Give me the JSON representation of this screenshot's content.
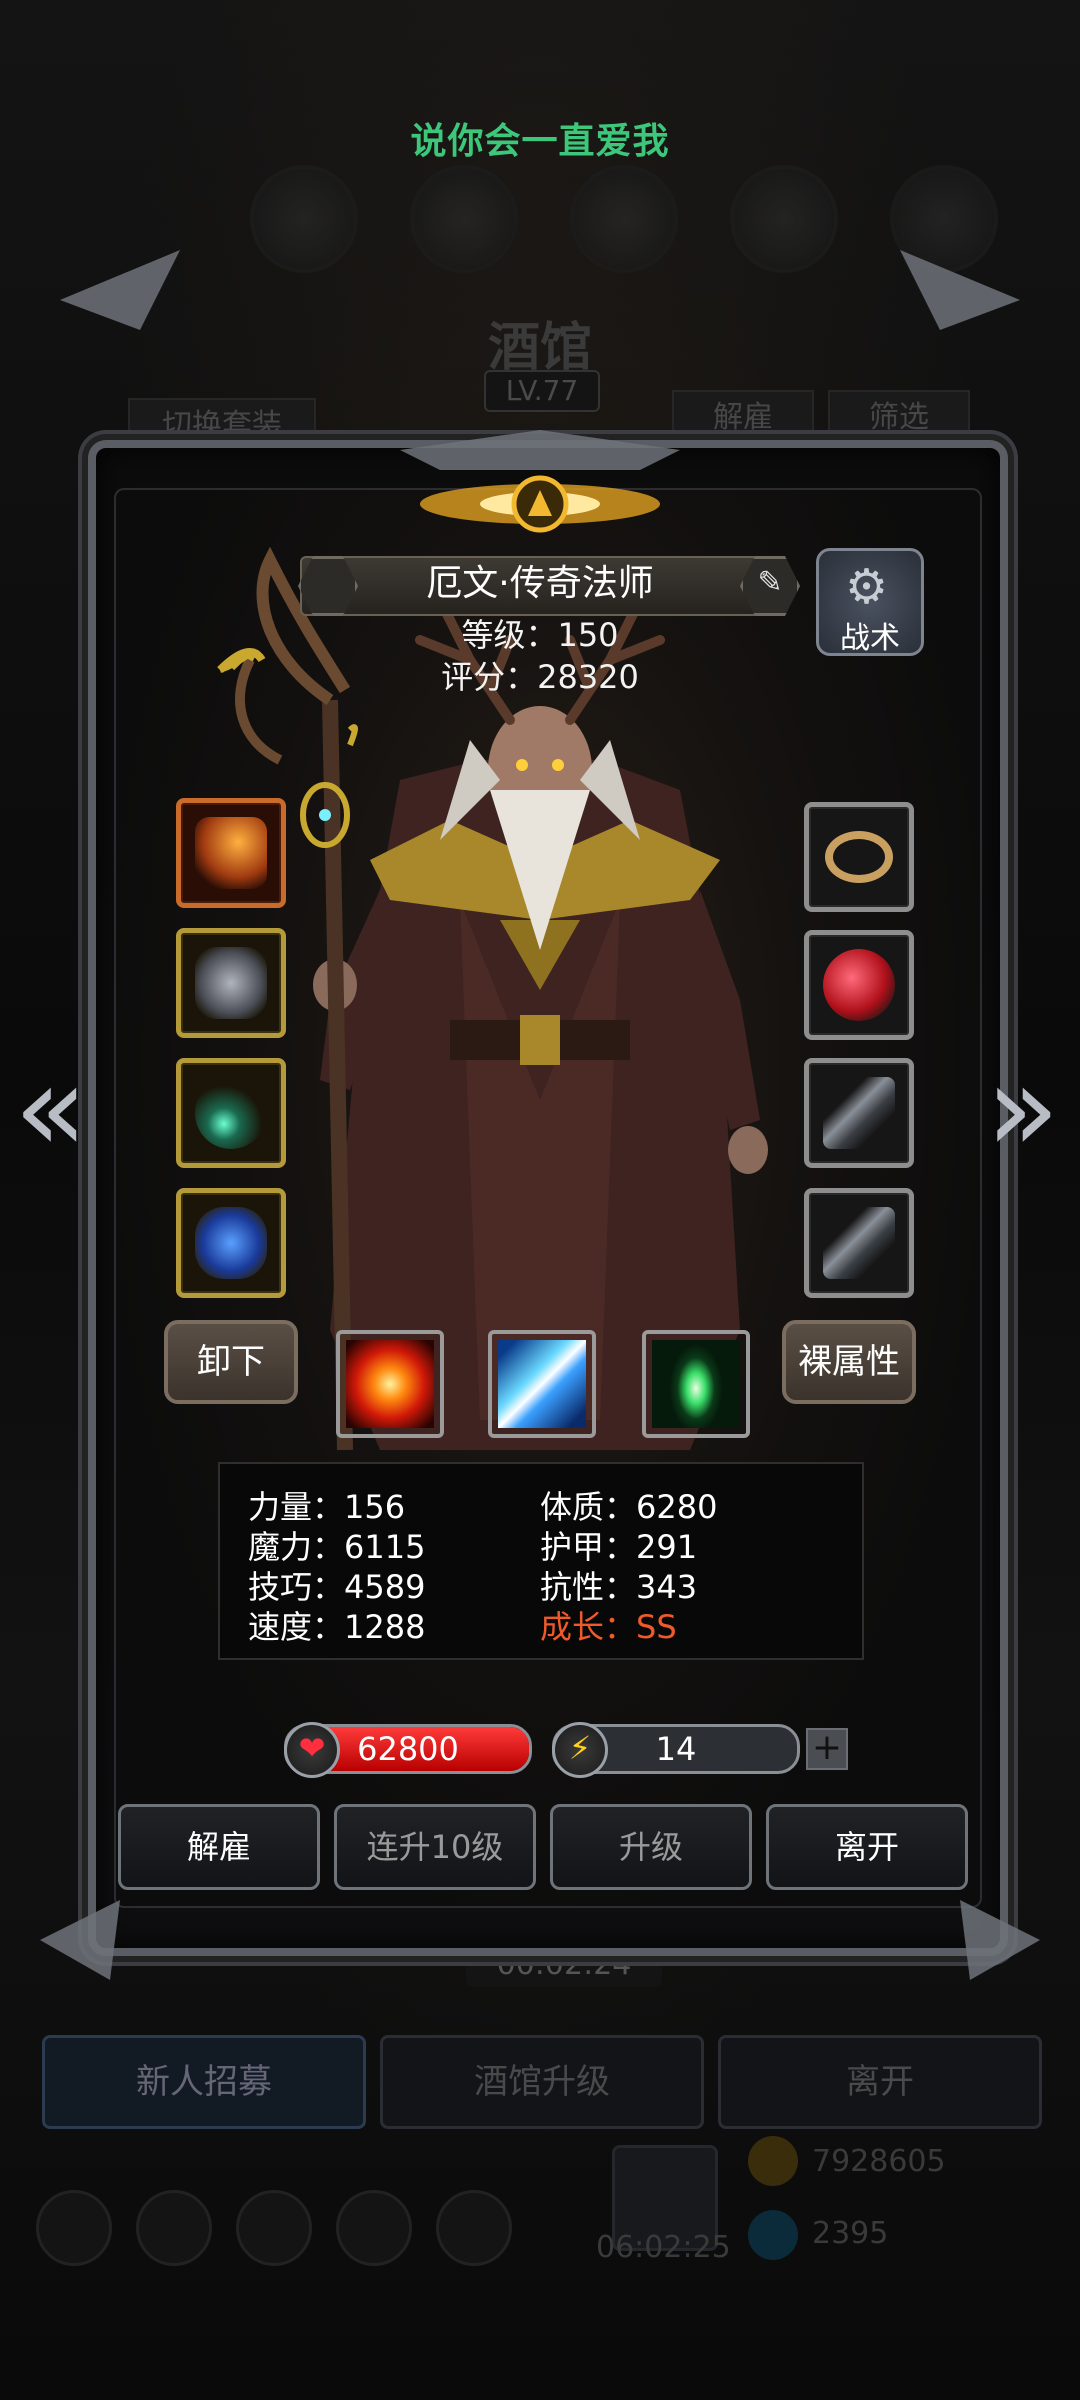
{
  "song_title": "说你会一直爱我",
  "background": {
    "tavern_title": "酒馆",
    "tavern_level": "LV.77",
    "switch_outfit": "切换套装",
    "dismiss": "解雇",
    "filter": "筛选",
    "timer": "00:02:24",
    "bottom_buttons": [
      "新人招募",
      "酒馆升级",
      "离开"
    ],
    "gold": "7928605",
    "gems": "2395",
    "gift_timer": "06:02:25"
  },
  "hero": {
    "name": "厄文·传奇法师",
    "level": "等级：150",
    "score": "评分：28320",
    "tactics_label": "战术",
    "unequip_label": "卸下",
    "naked_attr_label": "裸属性",
    "left_slots": [
      "staff-icon",
      "armor-icon",
      "amulet-icon",
      "blue-gem-icon"
    ],
    "right_slots": [
      "ring-icon",
      "red-orb-icon",
      "bracer-icon",
      "bracer-icon"
    ],
    "skills": [
      "fire-burst-icon",
      "ice-shard-icon",
      "green-light-icon"
    ]
  },
  "stats": {
    "strength": "力量：156",
    "magic": "魔力：6115",
    "skill": "技巧：4589",
    "speed": "速度：1288",
    "constitution": "体质：6280",
    "armor": "护甲：291",
    "resistance": "抗性：343",
    "growth": "成长：SS"
  },
  "bars": {
    "hp_value": "62800",
    "hp_fill": 1.0,
    "energy_value": "14",
    "energy_fill": 0.13
  },
  "actions": {
    "dismiss": "解雇",
    "level_up_10": "连升10级",
    "level_up": "升级",
    "leave": "离开"
  },
  "colors": {
    "song_title": "#3cc77a",
    "growth": "#f05a2a",
    "hp": "#e01010",
    "energy": "#f0c820"
  }
}
